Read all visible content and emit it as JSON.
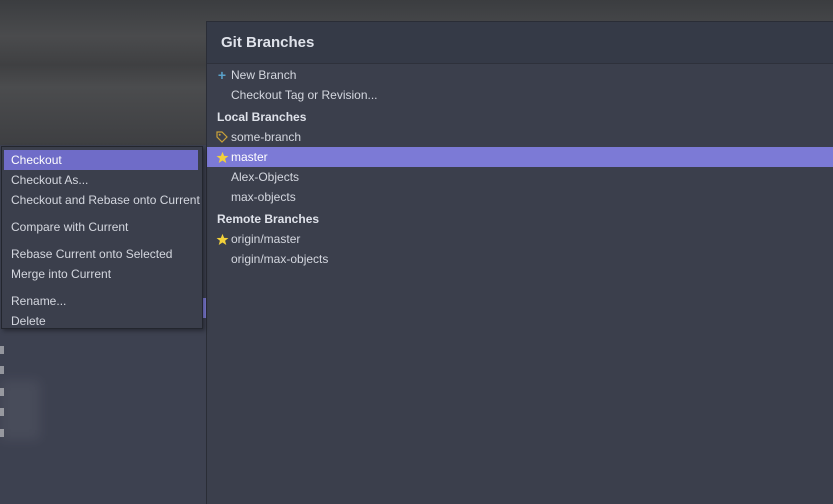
{
  "popup": {
    "title": "Git Branches",
    "actions": [
      {
        "label": "New Branch",
        "icon": "plus-icon"
      },
      {
        "label": "Checkout Tag or Revision..."
      }
    ],
    "local_section": "Local Branches",
    "local_branches": [
      {
        "label": "some-branch",
        "icon": "tag-icon"
      },
      {
        "label": "master",
        "icon": "star-icon",
        "selected": true
      },
      {
        "label": "Alex-Objects"
      },
      {
        "label": "max-objects"
      }
    ],
    "remote_section": "Remote Branches",
    "remote_branches": [
      {
        "label": "origin/master",
        "icon": "star-icon"
      },
      {
        "label": "origin/max-objects"
      }
    ]
  },
  "context_menu": {
    "items": [
      "Checkout",
      "Checkout As...",
      "Checkout and Rebase onto Current",
      "Compare with Current",
      "Rebase Current onto Selected",
      "Merge into Current",
      "Rename...",
      "Delete"
    ]
  },
  "colors": {
    "selection": "#7c7ad6",
    "popup_bg": "#3b3f4c",
    "star": "#f2d13a",
    "plus": "#5aa1c9"
  }
}
